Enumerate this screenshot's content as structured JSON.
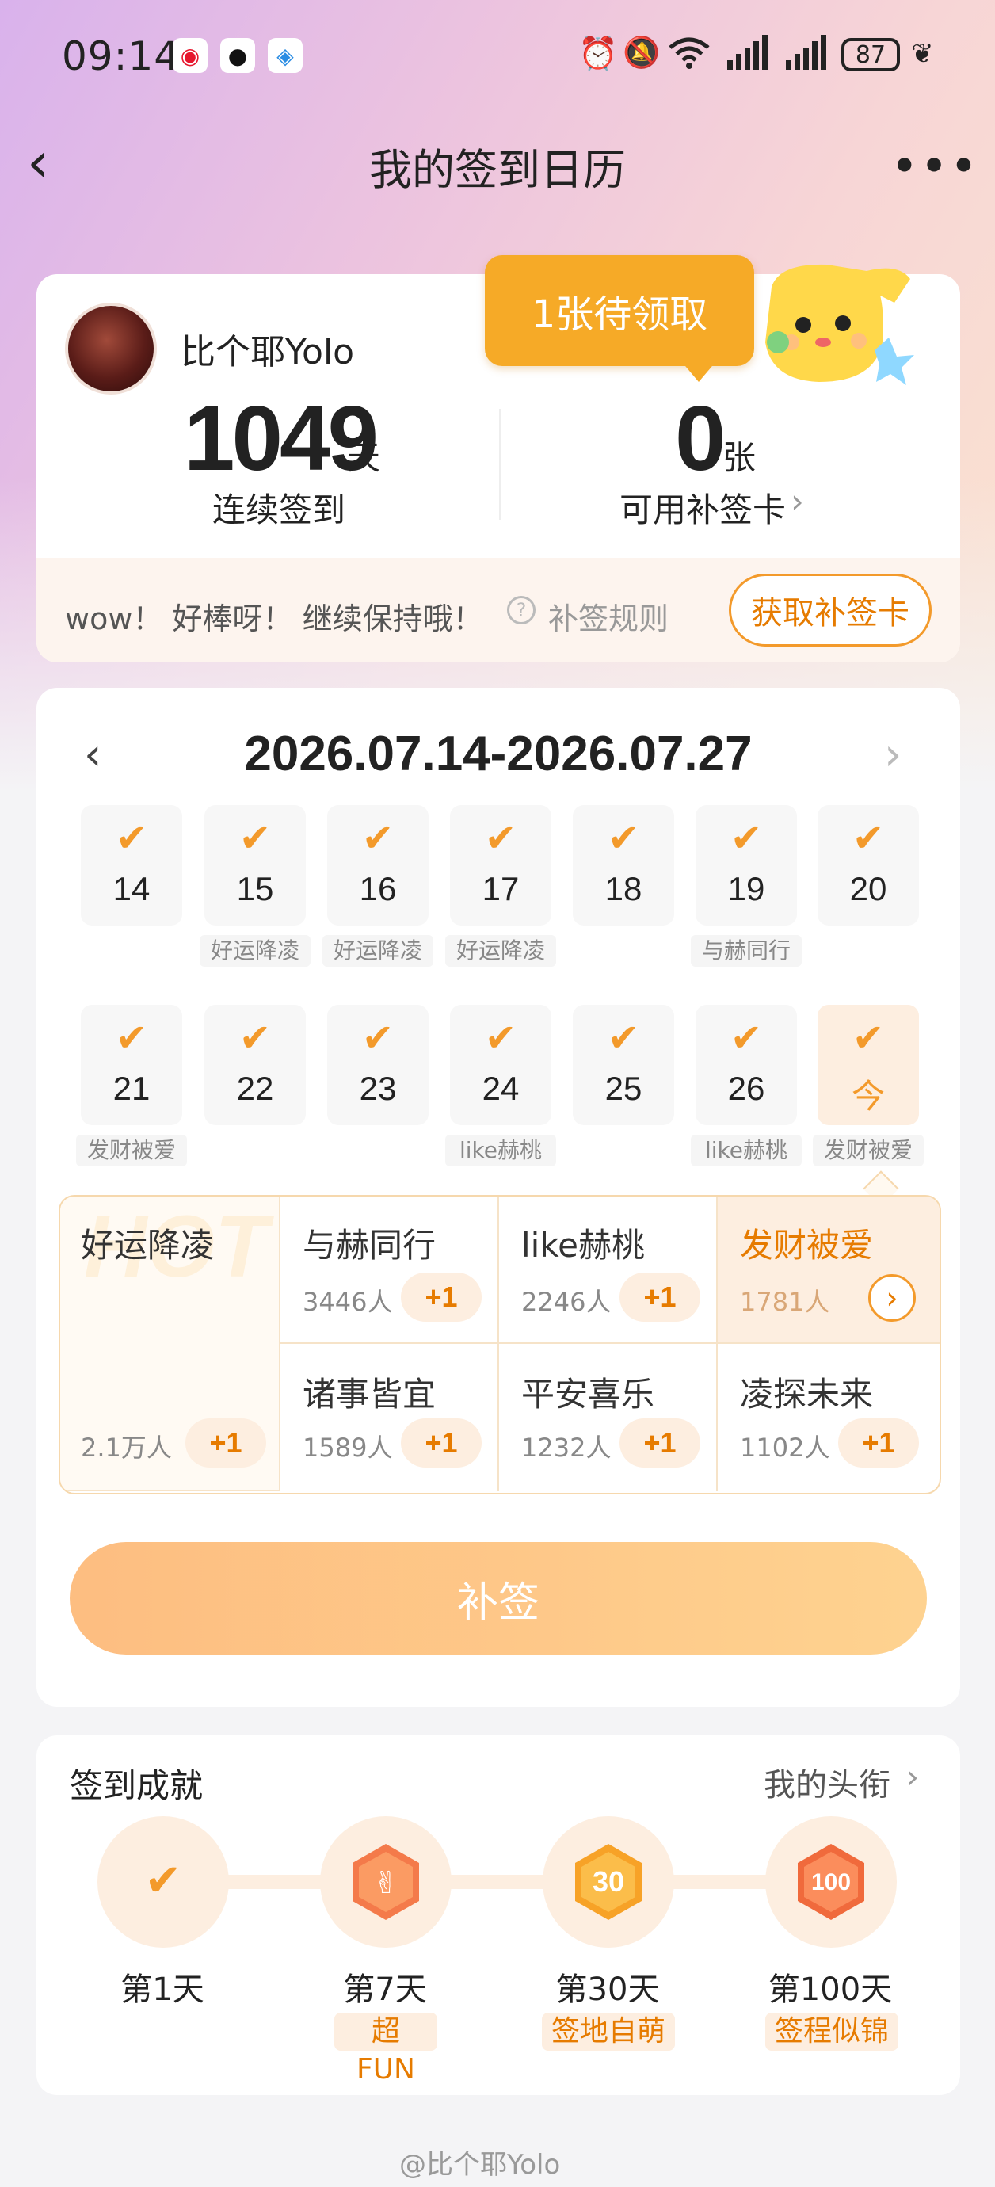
{
  "status_bar": {
    "time": "09:14",
    "app_icons": [
      "weibo-icon",
      "qq-icon",
      "browser-icon"
    ],
    "system_icons": [
      "alarm-icon",
      "mute-icon",
      "wifi-icon",
      "signal-icon",
      "signal-icon",
      "leaf-icon"
    ],
    "battery": "87"
  },
  "nav": {
    "title": "我的签到日历",
    "back_icon": "chevron-left-icon",
    "more_icon": "more-icon"
  },
  "profile": {
    "username": "比个耶Yolo",
    "streak_value": "1049",
    "streak_unit": "天",
    "streak_label": "连续签到",
    "cards_value": "0",
    "cards_unit": "张",
    "cards_label": "可用补签卡",
    "claim_bubble": "1张待领取",
    "praise": "wow！ 好棒呀！ 继续保持哦！",
    "rules_label": "补签规则",
    "get_card_button": "获取补签卡"
  },
  "calendar": {
    "range": "2026.07.14-2026.07.27",
    "weeks": [
      [
        {
          "day": "14",
          "tag": ""
        },
        {
          "day": "15",
          "tag": "好运降凌"
        },
        {
          "day": "16",
          "tag": "好运降凌"
        },
        {
          "day": "17",
          "tag": "好运降凌"
        },
        {
          "day": "18",
          "tag": ""
        },
        {
          "day": "19",
          "tag": "与赫同行"
        },
        {
          "day": "20",
          "tag": ""
        }
      ],
      [
        {
          "day": "21",
          "tag": "发财被爱"
        },
        {
          "day": "22",
          "tag": ""
        },
        {
          "day": "23",
          "tag": ""
        },
        {
          "day": "24",
          "tag": "like赫桃"
        },
        {
          "day": "25",
          "tag": ""
        },
        {
          "day": "26",
          "tag": "like赫桃"
        },
        {
          "day": "今",
          "tag": "发财被爱"
        }
      ]
    ],
    "check_icon": "check-icon"
  },
  "blessings": {
    "hot_label": "HOT",
    "featured": {
      "title": "好运降凌",
      "count": "2.1万人",
      "plus": "+1"
    },
    "items": [
      {
        "title": "与赫同行",
        "count": "3446人",
        "plus": "+1"
      },
      {
        "title": "like赫桃",
        "count": "2246人",
        "plus": "+1"
      },
      {
        "title": "发财被爱",
        "count": "1781人",
        "plus": ""
      },
      {
        "title": "诸事皆宜",
        "count": "1589人",
        "plus": "+1"
      },
      {
        "title": "平安喜乐",
        "count": "1232人",
        "plus": "+1"
      },
      {
        "title": "凌探未来",
        "count": "1102人",
        "plus": "+1"
      }
    ],
    "accent": "#f39a2b"
  },
  "resign_button": "补签",
  "achievements": {
    "title": "签到成就",
    "link": "我的头衔",
    "milestones": [
      {
        "day": "第1天",
        "tag": ""
      },
      {
        "day": "第7天",
        "tag": "超FUN"
      },
      {
        "day": "第30天",
        "tag": "签地自萌"
      },
      {
        "day": "第100天",
        "tag": "签程似锦"
      }
    ],
    "badge_30_text": "30",
    "badge_100_text": "100"
  },
  "watermark": "@比个耶Yolo"
}
